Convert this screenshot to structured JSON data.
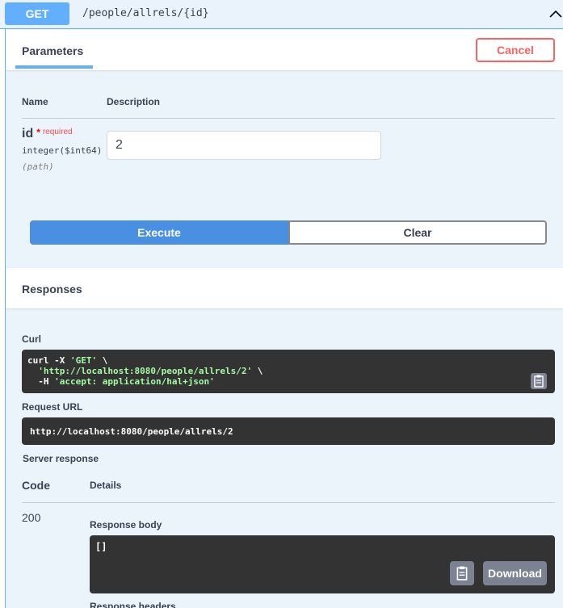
{
  "summary": {
    "method": "GET",
    "path": "/people/allrels/{id}"
  },
  "parameters": {
    "tab_label": "Parameters",
    "cancel_label": "Cancel",
    "col_name": "Name",
    "col_description": "Description",
    "items": [
      {
        "name": "id",
        "required_star": "*",
        "required_label": "required",
        "type": "integer($int64)",
        "location": "(path)",
        "value": "2"
      }
    ]
  },
  "actions": {
    "execute_label": "Execute",
    "clear_label": "Clear"
  },
  "responses": {
    "title": "Responses",
    "curl_label": "Curl",
    "curl": {
      "line1_cmd": "curl -X ",
      "line1_method": "'GET'",
      "line1_end": " \\",
      "line2_indent": "  ",
      "line2_url": "'http://localhost:8080/people/allrels/2'",
      "line2_end": " \\",
      "line3_flag": "  -H ",
      "line3_header": "'accept: application/hal+json'"
    },
    "request_url_label": "Request URL",
    "request_url": "http://localhost:8080/people/allrels/2",
    "server_response_label": "Server response",
    "code_header": "Code",
    "details_header": "Details",
    "status_code": "200",
    "response_body_label": "Response body",
    "response_body": "[]",
    "download_label": "Download",
    "response_headers_label": "Response headers"
  },
  "colors": {
    "get_accent": "#61affe",
    "execute_blue": "#4990e2",
    "cancel_red": "#ff6060",
    "code_bg": "#333333",
    "string_green": "#a2fca2"
  }
}
